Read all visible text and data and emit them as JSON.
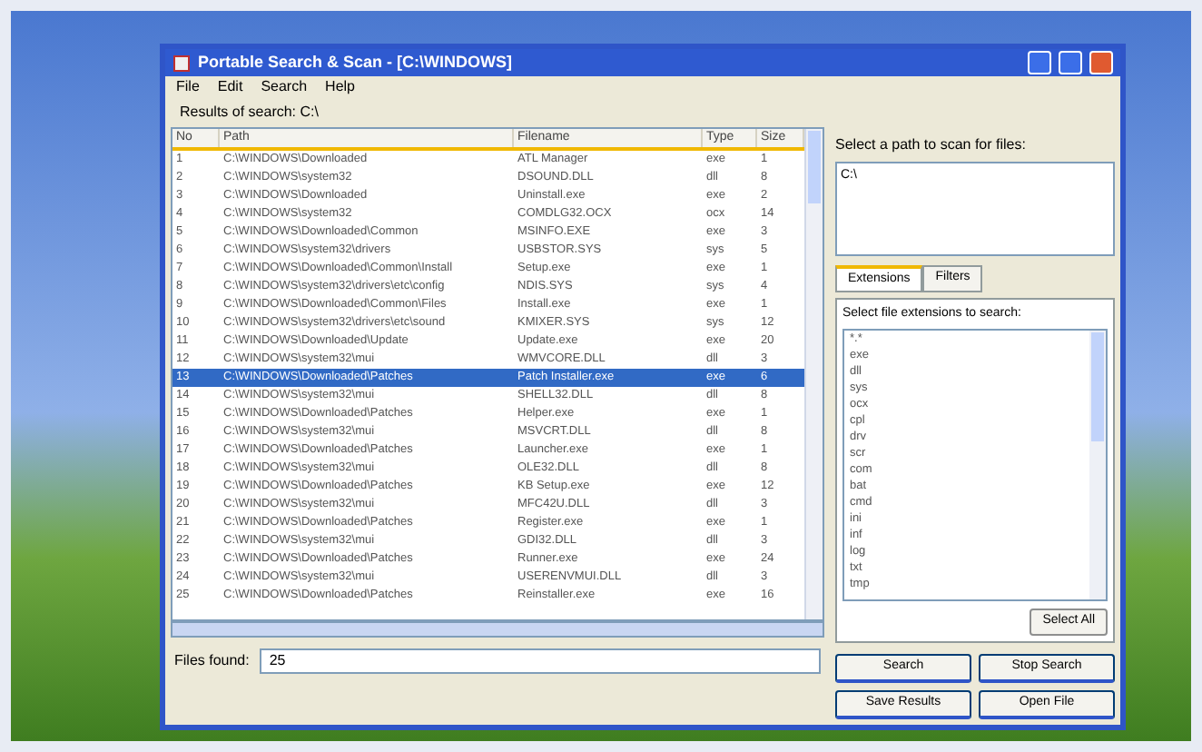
{
  "window": {
    "title": "Portable Search & Scan - [C:\\WINDOWS]"
  },
  "menu": [
    {
      "label": "File"
    },
    {
      "label": "Edit"
    },
    {
      "label": "Search"
    },
    {
      "label": "Help"
    }
  ],
  "path_label": "Results of search: C:\\",
  "table": {
    "columns": [
      "No",
      "Path",
      "Filename",
      "Type",
      "Size"
    ],
    "rows": [
      {
        "no": "1",
        "path": "C:\\WINDOWS\\Downloaded",
        "filename": "ATL Manager",
        "type": "exe",
        "size": "1",
        "selected": false
      },
      {
        "no": "2",
        "path": "C:\\WINDOWS\\system32",
        "filename": "DSOUND.DLL",
        "type": "dll",
        "size": "8",
        "selected": false
      },
      {
        "no": "3",
        "path": "C:\\WINDOWS\\Downloaded",
        "filename": "Uninstall.exe",
        "type": "exe",
        "size": "2",
        "selected": false
      },
      {
        "no": "4",
        "path": "C:\\WINDOWS\\system32",
        "filename": "COMDLG32.OCX",
        "type": "ocx",
        "size": "14",
        "selected": false
      },
      {
        "no": "5",
        "path": "C:\\WINDOWS\\Downloaded\\Common",
        "filename": "MSINFO.EXE",
        "type": "exe",
        "size": "3",
        "selected": false
      },
      {
        "no": "6",
        "path": "C:\\WINDOWS\\system32\\drivers",
        "filename": "USBSTOR.SYS",
        "type": "sys",
        "size": "5",
        "selected": false
      },
      {
        "no": "7",
        "path": "C:\\WINDOWS\\Downloaded\\Common\\Install",
        "filename": "Setup.exe",
        "type": "exe",
        "size": "1",
        "selected": false
      },
      {
        "no": "8",
        "path": "C:\\WINDOWS\\system32\\drivers\\etc\\config",
        "filename": "NDIS.SYS",
        "type": "sys",
        "size": "4",
        "selected": false
      },
      {
        "no": "9",
        "path": "C:\\WINDOWS\\Downloaded\\Common\\Files",
        "filename": "Install.exe",
        "type": "exe",
        "size": "1",
        "selected": false
      },
      {
        "no": "10",
        "path": "C:\\WINDOWS\\system32\\drivers\\etc\\sound",
        "filename": "KMIXER.SYS",
        "type": "sys",
        "size": "12",
        "selected": false
      },
      {
        "no": "11",
        "path": "C:\\WINDOWS\\Downloaded\\Update",
        "filename": "Update.exe",
        "type": "exe",
        "size": "20",
        "selected": false
      },
      {
        "no": "12",
        "path": "C:\\WINDOWS\\system32\\mui",
        "filename": "WMVCORE.DLL",
        "type": "dll",
        "size": "3",
        "selected": false
      },
      {
        "no": "13",
        "path": "C:\\WINDOWS\\Downloaded\\Patches",
        "filename": "Patch Installer.exe",
        "type": "exe",
        "size": "6",
        "selected": true
      },
      {
        "no": "14",
        "path": "C:\\WINDOWS\\system32\\mui",
        "filename": "SHELL32.DLL",
        "type": "dll",
        "size": "8",
        "selected": false
      },
      {
        "no": "15",
        "path": "C:\\WINDOWS\\Downloaded\\Patches",
        "filename": "Helper.exe",
        "type": "exe",
        "size": "1",
        "selected": false
      },
      {
        "no": "16",
        "path": "C:\\WINDOWS\\system32\\mui",
        "filename": "MSVCRT.DLL",
        "type": "dll",
        "size": "8",
        "selected": false
      },
      {
        "no": "17",
        "path": "C:\\WINDOWS\\Downloaded\\Patches",
        "filename": "Launcher.exe",
        "type": "exe",
        "size": "1",
        "selected": false
      },
      {
        "no": "18",
        "path": "C:\\WINDOWS\\system32\\mui",
        "filename": "OLE32.DLL",
        "type": "dll",
        "size": "8",
        "selected": false
      },
      {
        "no": "19",
        "path": "C:\\WINDOWS\\Downloaded\\Patches",
        "filename": "KB Setup.exe",
        "type": "exe",
        "size": "12",
        "selected": false
      },
      {
        "no": "20",
        "path": "C:\\WINDOWS\\system32\\mui",
        "filename": "MFC42U.DLL",
        "type": "dll",
        "size": "3",
        "selected": false
      },
      {
        "no": "21",
        "path": "C:\\WINDOWS\\Downloaded\\Patches",
        "filename": "Register.exe",
        "type": "exe",
        "size": "1",
        "selected": false
      },
      {
        "no": "22",
        "path": "C:\\WINDOWS\\system32\\mui",
        "filename": "GDI32.DLL",
        "type": "dll",
        "size": "3",
        "selected": false
      },
      {
        "no": "23",
        "path": "C:\\WINDOWS\\Downloaded\\Patches",
        "filename": "Runner.exe",
        "type": "exe",
        "size": "24",
        "selected": false
      },
      {
        "no": "24",
        "path": "C:\\WINDOWS\\system32\\mui",
        "filename": "USERENVMUI.DLL",
        "type": "dll",
        "size": "3",
        "selected": false
      },
      {
        "no": "25",
        "path": "C:\\WINDOWS\\Downloaded\\Patches",
        "filename": "Reinstaller.exe",
        "type": "exe",
        "size": "16",
        "selected": false
      }
    ]
  },
  "results": {
    "label": "Files found:",
    "value": "25"
  },
  "scan": {
    "label": "Select a path to scan for files:",
    "value": "C:\\"
  },
  "tabs": [
    {
      "label": "Extensions",
      "selected": true
    },
    {
      "label": "Filters",
      "selected": false
    }
  ],
  "extensions": {
    "label": "Select file extensions to search:",
    "items": [
      "*.*",
      "exe",
      "dll",
      "sys",
      "ocx",
      "cpl",
      "drv",
      "scr",
      "com",
      "bat",
      "cmd",
      "ini",
      "inf",
      "log",
      "txt",
      "tmp"
    ]
  },
  "select_all": "Select All",
  "buttons": [
    {
      "label": "Search"
    },
    {
      "label": "Stop Search"
    },
    {
      "label": "Save Results"
    },
    {
      "label": "Open File"
    }
  ]
}
